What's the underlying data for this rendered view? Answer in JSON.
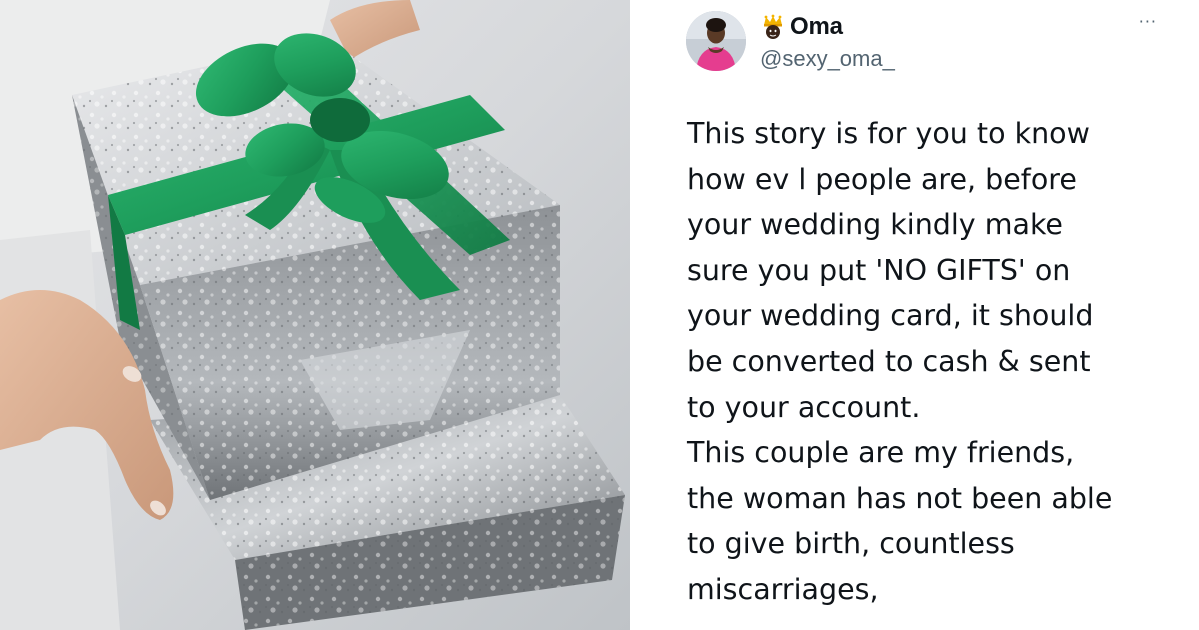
{
  "tweet": {
    "display_name": "Oma",
    "name_emoji": "crown-face-emoji",
    "handle": "@sexy_oma_",
    "more_label": "···",
    "body_lines": [
      "This story is for you to know",
      "how ev l people are, before",
      "your wedding kindly make",
      "sure you put 'NO GIFTS' on",
      "your wedding card, it should",
      "be converted to cash & sent",
      "to your account.",
      "This couple are my friends,",
      "the woman has not been able",
      "to give birth, countless",
      "miscarriages,"
    ]
  },
  "photo": {
    "subject": "gift-boxes-icon",
    "ribbon_color": "#1e9e5c",
    "paper_color": "#cfd2d6"
  }
}
